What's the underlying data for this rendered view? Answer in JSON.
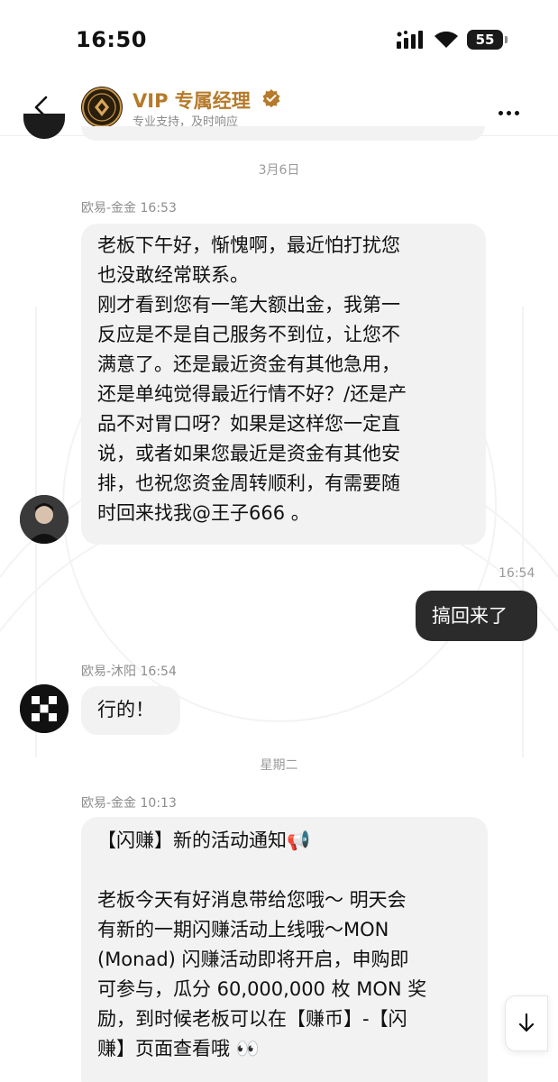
{
  "status_bar": {
    "time": "16:50",
    "battery": "55"
  },
  "header": {
    "title": "VIP 专属经理",
    "subtitle": "专业支持，及时响应"
  },
  "chat": {
    "date1": "3月6日",
    "msg1": {
      "sender": "欧易-金金 16:53",
      "lines": [
        "老板下午好，惭愧啊，最近怕打扰您",
        "也没敢经常联系。",
        "刚才看到您有一笔大额出金，我第一",
        "反应是不是自己服务不到位，让您不",
        "满意了。还是最近资金有其他急用，",
        "还是单纯觉得最近行情不好？/还是产",
        "品不对胃口呀？如果是这样您一定直",
        "说，或者如果您最近是资金有其他安",
        "排，也祝您资金周转顺利，有需要随",
        "时回来找我@王子666 。"
      ]
    },
    "my_msg": {
      "time": "16:54",
      "text": "搞回来了"
    },
    "msg2": {
      "sender": "欧易-沐阳 16:54",
      "text": "行的！"
    },
    "date2": "星期二",
    "msg3": {
      "sender": "欧易-金金 10:13",
      "lines": [
        "【闪赚】新的活动通知📢",
        "",
        "老板今天有好消息带给您哦～ 明天会",
        "有新的一期闪赚活动上线哦～MON",
        "(Monad) 闪赚活动即将开启，申购即",
        "可参与，瓜分 60,000,000 枚 MON 奖",
        "励，到时候老板可以在【赚币】-【闪",
        "赚】页面查看哦 👀"
      ]
    }
  },
  "icons": {
    "back": "chevron-left-icon",
    "more": "more-dots-icon",
    "scroll": "arrow-down-icon",
    "verified": "verified-badge-icon"
  },
  "colors": {
    "accent": "#b57a2a",
    "bubble_in": "#f2f2f2",
    "bubble_out": "#2b2b2b"
  }
}
